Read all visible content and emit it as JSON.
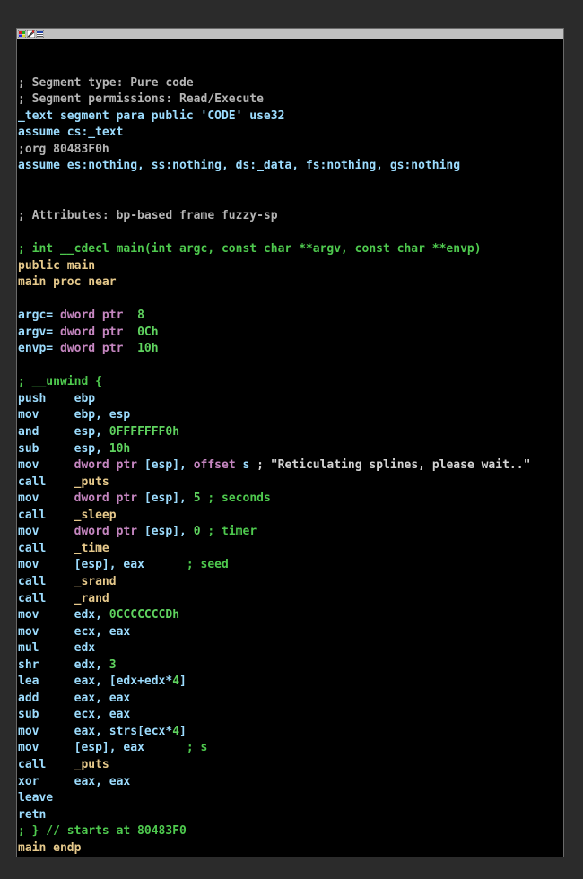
{
  "window": {
    "icons": [
      "graph-view-icon",
      "edit-icon",
      "hex-view-icon"
    ]
  },
  "lines": [
    "",
    "; Segment type: Pure code",
    "; Segment permissions: Read/Execute",
    "_text segment para public 'CODE' use32",
    "assume cs:_text",
    ";org 80483F0h",
    "assume es:nothing, ss:nothing, ds:_data, fs:nothing, gs:nothing",
    "",
    "",
    "; Attributes: bp-based frame fuzzy-sp",
    "",
    "; int __cdecl main(int argc, const char **argv, const char **envp)",
    "public main",
    "main proc near",
    "",
    "argc= dword ptr  8",
    "argv= dword ptr  0Ch",
    "envp= dword ptr  10h",
    "",
    "; __unwind {",
    "push    ebp",
    "mov     ebp, esp",
    "and     esp, 0FFFFFFF0h",
    "sub     esp, 10h",
    "mov     dword ptr [esp], offset s ; \"Reticulating splines, please wait..\"",
    "call    _puts",
    "mov     dword ptr [esp], 5 ; seconds",
    "call    _sleep",
    "mov     dword ptr [esp], 0 ; timer",
    "call    _time",
    "mov     [esp], eax      ; seed",
    "call    _srand",
    "call    _rand",
    "mov     edx, 0CCCCCCCDh",
    "mov     ecx, eax",
    "mul     edx",
    "shr     edx, 3",
    "lea     eax, [edx+edx*4]",
    "add     eax, eax",
    "sub     ecx, eax",
    "mov     eax, strs[ecx*4]",
    "mov     [esp], eax      ; s",
    "call    _puts",
    "xor     eax, eax",
    "leave",
    "retn",
    "; } // starts at 80483F0",
    "main endp"
  ],
  "colors": {
    "comment": "#b4b4b4",
    "green": "#4ec94e",
    "keyword": "#e6c98b",
    "type": "#c586c0",
    "operand": "#9cdcfe"
  }
}
